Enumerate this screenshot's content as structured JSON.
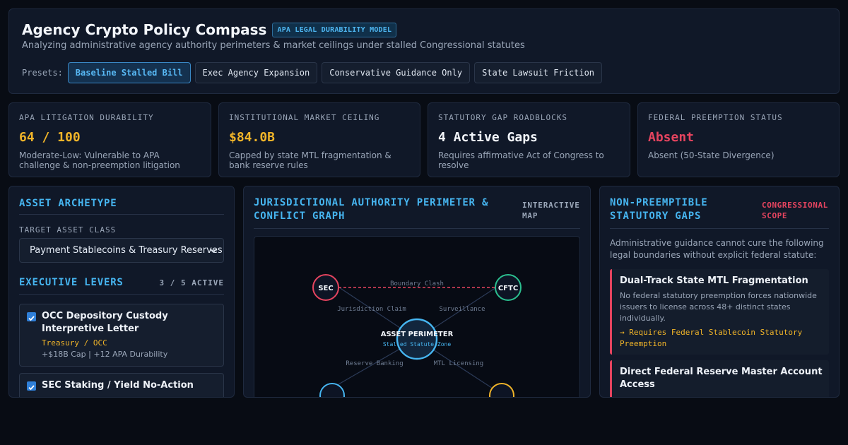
{
  "header": {
    "title": "Agency Crypto Policy Compass",
    "badge": "APA LEGAL DURABILITY MODEL",
    "subtitle": "Analyzing administrative agency authority perimeters & market ceilings under stalled Congressional statutes",
    "presets_label": "Presets:",
    "presets": [
      {
        "label": "Baseline Stalled Bill",
        "active": true
      },
      {
        "label": "Exec Agency Expansion",
        "active": false
      },
      {
        "label": "Conservative Guidance Only",
        "active": false
      },
      {
        "label": "State Lawsuit Friction",
        "active": false
      }
    ]
  },
  "stats": [
    {
      "label": "APA LITIGATION DURABILITY",
      "value": "64 / 100",
      "note": "Moderate-Low: Vulnerable to APA challenge & non-preemption litigation",
      "color": "#f0b429"
    },
    {
      "label": "INSTITUTIONAL MARKET CEILING",
      "value": "$84.0B",
      "note": "Capped by state MTL fragmentation & bank reserve rules",
      "color": "#f0b429"
    },
    {
      "label": "STATUTORY GAP ROADBLOCKS",
      "value": "4 Active Gaps",
      "note": "Requires affirmative Act of Congress to resolve",
      "color": "#f3f6fb"
    },
    {
      "label": "FEDERAL PREEMPTION STATUS",
      "value": "Absent",
      "note": "Absent (50-State Divergence)",
      "color": "#e5445f"
    }
  ],
  "asset_panel": {
    "title": "ASSET ARCHETYPE",
    "field_label": "TARGET ASSET CLASS",
    "selected": "Payment Stablecoins & Treasury Reserves"
  },
  "levers": {
    "title": "EXECUTIVE LEVERS",
    "count": "3 / 5 ACTIVE",
    "items": [
      {
        "title": "OCC Depository Custody Interpretive Letter",
        "agency": "Treasury / OCC",
        "impact": "+$18B Cap | +12 APA Durability"
      },
      {
        "title": "SEC Staking / Yield No-Action",
        "agency": "",
        "impact": ""
      }
    ]
  },
  "graph": {
    "title": "JURISDICTIONAL AUTHORITY PERIMETER & CONFLICT GRAPH",
    "tag": "INTERACTIVE MAP",
    "center": {
      "label": "ASSET PERIMETER",
      "sub": "Stalled Statute Zone"
    },
    "nodes": {
      "sec": "SEC",
      "cftc": "CFTC"
    },
    "edges": {
      "clash": "Boundary Clash",
      "jurisdiction": "Jurisdiction Claim",
      "surveillance": "Surveillance",
      "reserve": "Reserve Banking",
      "mtl": "MTL Licensing"
    },
    "colors": {
      "sec": "#e5445f",
      "cftc": "#2bbf8f",
      "center": "#46b5f0"
    }
  },
  "gaps": {
    "title_line1": "NON-PREEMPTIBLE",
    "title_line2": "STATUTORY GAPS",
    "scope_line1": "CONGRESSIONAL",
    "scope_line2": "SCOPE",
    "intro": "Administrative guidance cannot cure the following legal boundaries without explicit federal statute:",
    "items": [
      {
        "title": "Dual-Track State MTL Fragmentation",
        "desc": "No federal statutory preemption forces nationwide issuers to license across 48+ distinct states individually.",
        "req": "→ Requires Federal Stablecoin Statutory Preemption"
      },
      {
        "title": "Direct Federal Reserve Master Account Access",
        "desc": "",
        "req": ""
      }
    ]
  }
}
